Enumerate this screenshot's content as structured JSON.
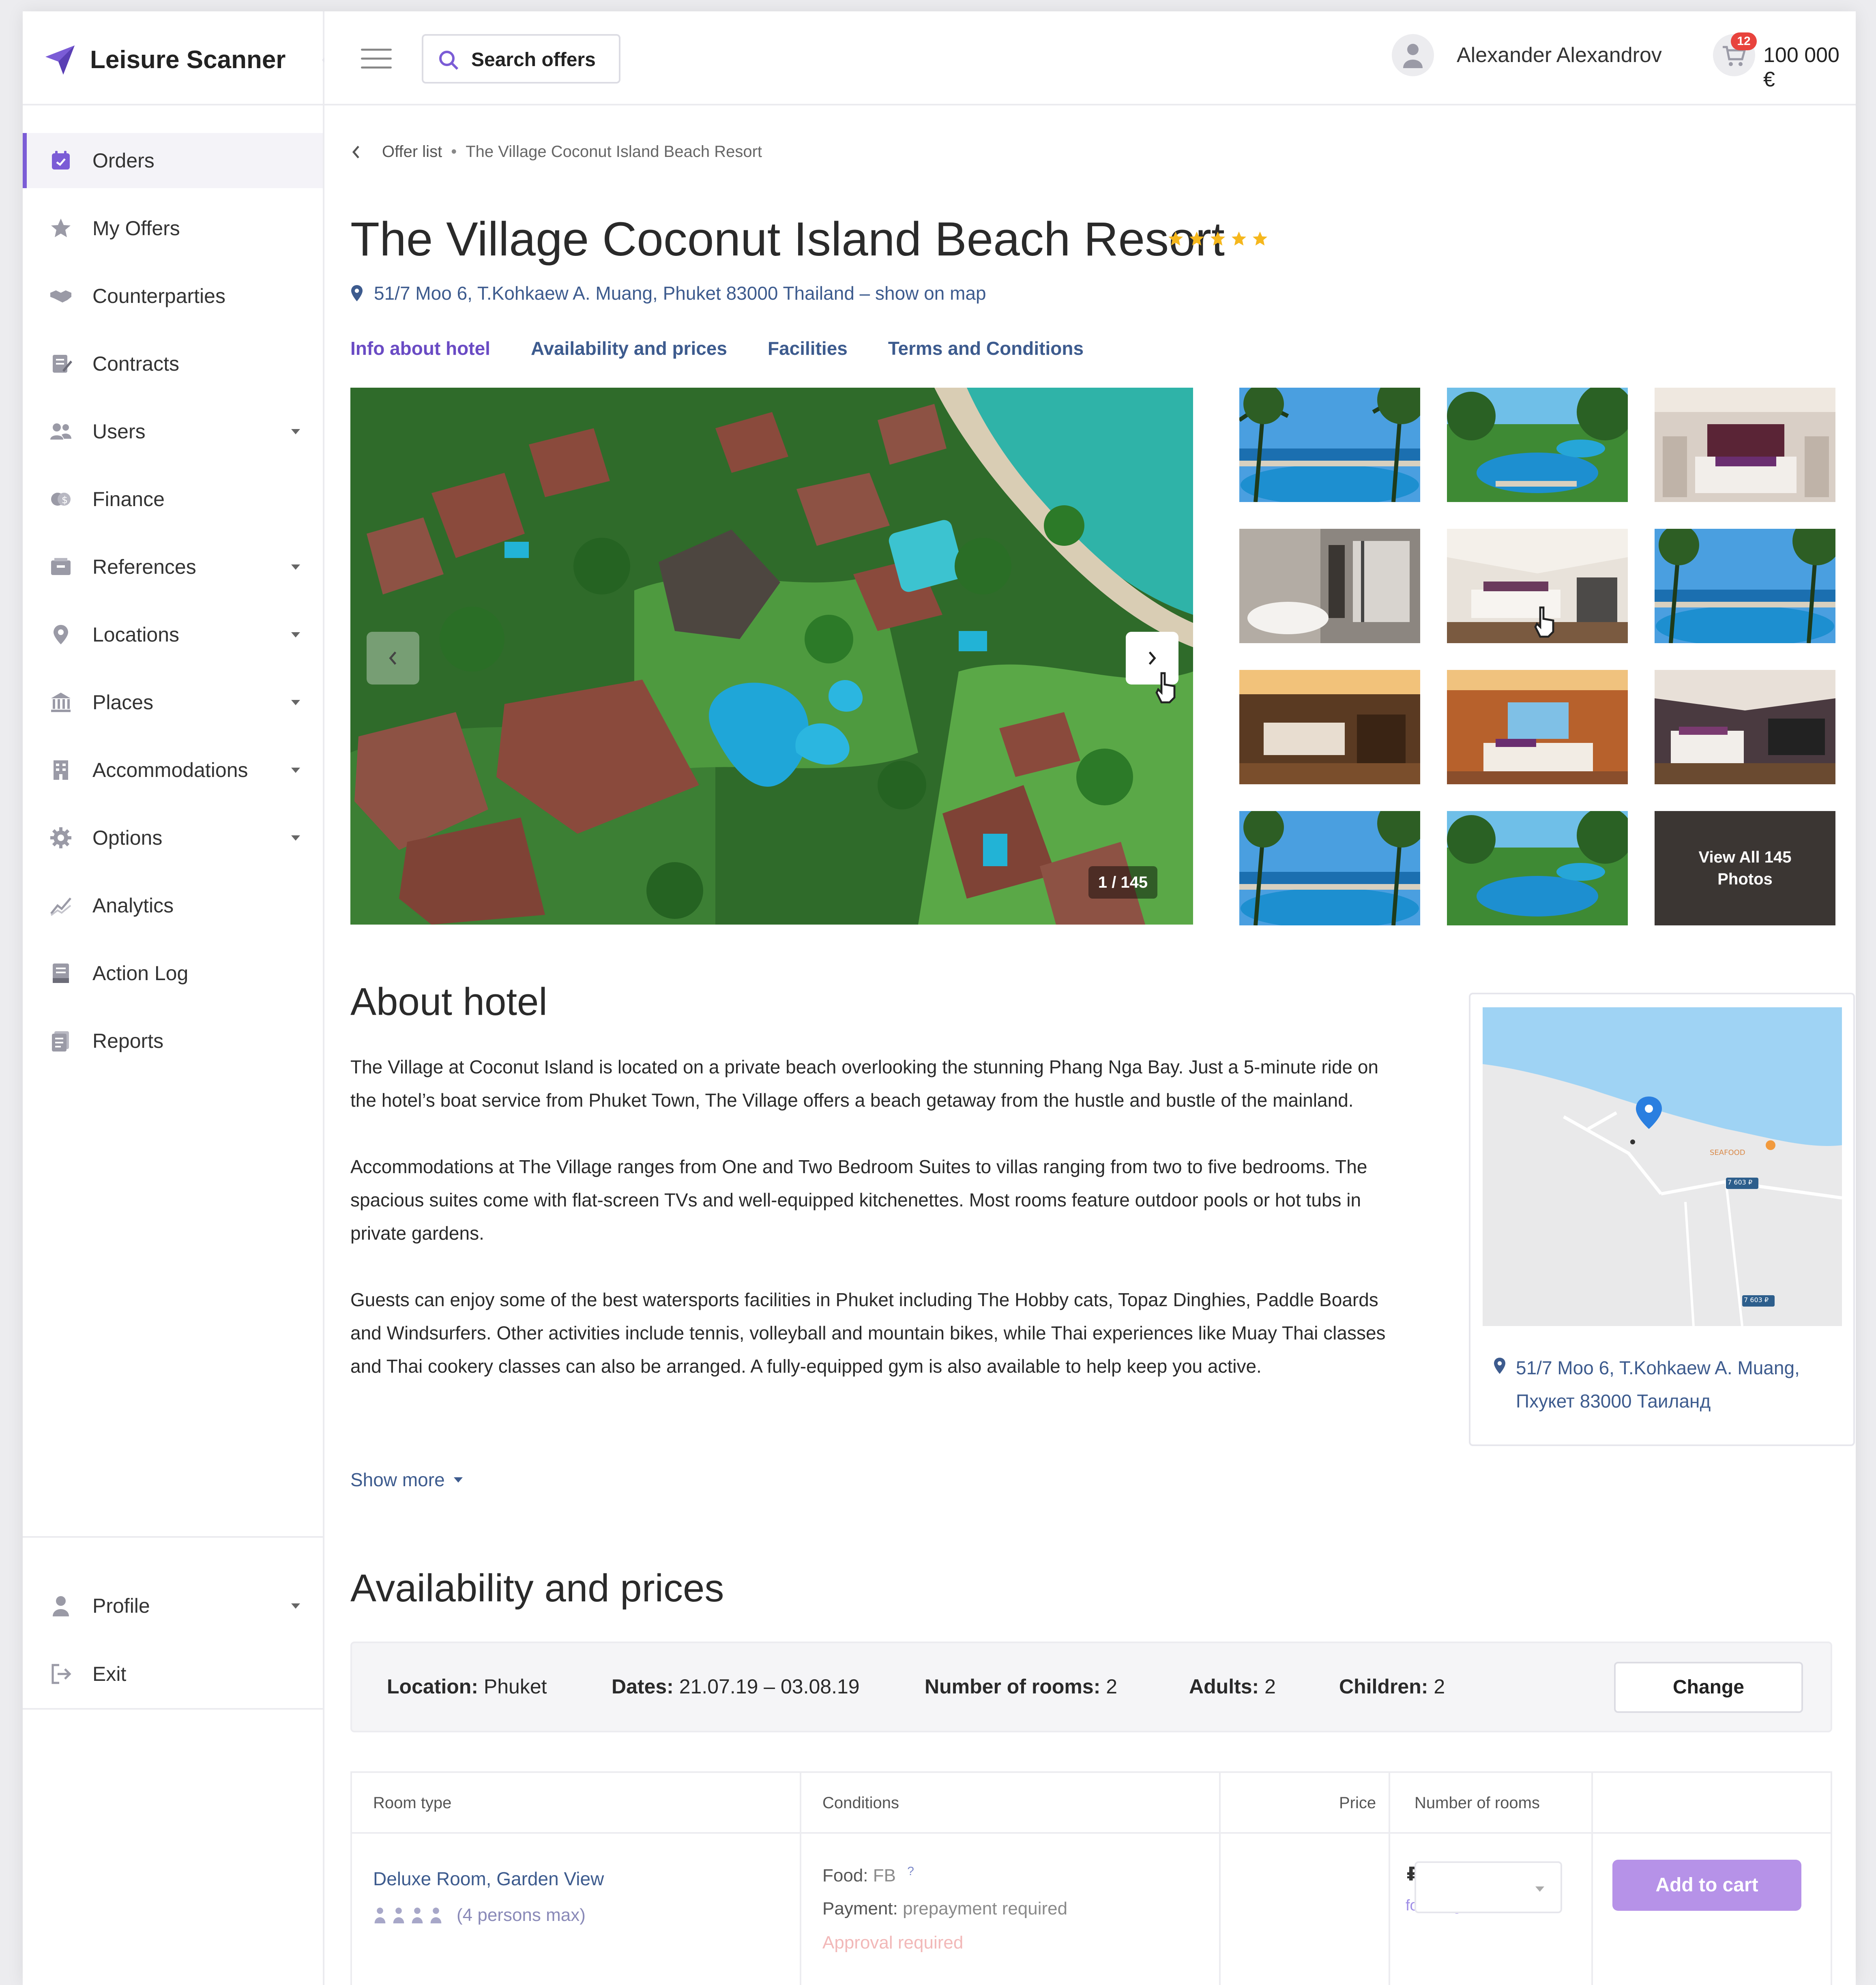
{
  "app": {
    "brand": "Leisure Scanner",
    "accent_color": "#7b5cd6"
  },
  "sidebar": {
    "items": [
      {
        "label": "Orders",
        "icon": "orders-icon",
        "active": true,
        "has_caret": false
      },
      {
        "label": "My Offers",
        "icon": "star-icon",
        "active": false,
        "has_caret": false
      },
      {
        "label": "Counterparties",
        "icon": "handshake-icon",
        "active": false,
        "has_caret": false
      },
      {
        "label": "Contracts",
        "icon": "contract-icon",
        "active": false,
        "has_caret": false
      },
      {
        "label": "Users",
        "icon": "users-icon",
        "active": false,
        "has_caret": true
      },
      {
        "label": "Finance",
        "icon": "coins-icon",
        "active": false,
        "has_caret": false
      },
      {
        "label": "References",
        "icon": "inbox-icon",
        "active": false,
        "has_caret": true
      },
      {
        "label": "Locations",
        "icon": "location-pin-icon",
        "active": false,
        "has_caret": true
      },
      {
        "label": "Places",
        "icon": "building-icon",
        "active": false,
        "has_caret": true
      },
      {
        "label": "Accommodations",
        "icon": "hotel-icon",
        "active": false,
        "has_caret": true
      },
      {
        "label": "Options",
        "icon": "gear-icon",
        "active": false,
        "has_caret": true
      },
      {
        "label": "Analytics",
        "icon": "chart-line-icon",
        "active": false,
        "has_caret": false
      },
      {
        "label": "Action Log",
        "icon": "log-icon",
        "active": false,
        "has_caret": false
      },
      {
        "label": "Reports",
        "icon": "report-icon",
        "active": false,
        "has_caret": false
      }
    ],
    "bottom": [
      {
        "label": "Profile",
        "icon": "user-icon",
        "has_caret": true
      },
      {
        "label": "Exit",
        "icon": "exit-icon",
        "has_caret": false
      }
    ]
  },
  "header": {
    "search_label": "Search offers",
    "user_name": "Alexander Alexandrov",
    "cart_count": "12",
    "balance": "100 000 €"
  },
  "breadcrumb": {
    "parent": "Offer list",
    "separator": "•",
    "current": "The Village Coconut Island Beach Resort"
  },
  "hotel": {
    "title": "The Village Coconut Island Beach Resort",
    "stars": 5,
    "address": "51/7 Moo 6, T.Kohkaew A. Muang, Phuket 83000 Thailand – show on map",
    "star_color": "#f5b71d"
  },
  "tabs": [
    {
      "label": "Info about hotel",
      "active": true
    },
    {
      "label": "Availability and prices",
      "active": false
    },
    {
      "label": "Facilities",
      "active": false
    },
    {
      "label": "Terms and Conditions",
      "active": false
    }
  ],
  "gallery": {
    "counter": "1 / 145",
    "view_all": "View All 145 Photos",
    "thumbs": [
      "pool-sea",
      "pool-garden",
      "bedroom",
      "bathroom",
      "living-room",
      "pool-sea",
      "lounge-warm",
      "living-sea-view",
      "bedroom-purple",
      "pool-sea",
      "pool-garden"
    ]
  },
  "about": {
    "title": "About hotel",
    "paragraphs": [
      "The Village at Coconut Island is located on a private beach overlooking the stunning Phang Nga Bay. Just a 5-minute ride on the hotel’s boat service from Phuket Town, The Village offers a beach getaway from the hustle and bustle of the mainland.",
      "Accommodations at The Village ranges from One and Two Bedroom Suites to villas ranging from two to five bedrooms. The spacious suites come with flat-screen TVs and well-equipped kitchenettes. Most rooms feature outdoor pools or hot tubs in private gardens.",
      "Guests can enjoy some of the best watersports facilities in Phuket including The Hobby cats, Topaz Dinghies, Paddle Boards and Windsurfers. Other activities include tennis, volleyball and mountain bikes, while Thai experiences like Muay Thai classes and Thai cookery classes can also be arranged. A fully-equipped gym is also available to help keep you active."
    ],
    "show_more": "Show more"
  },
  "map": {
    "address": "51/7 Moo 6, T.Kohkaew A. Muang, Пхукет 83000 Таиланд",
    "label_seafood": "SEAFOOD",
    "label_road_1": "7 603 ₽",
    "label_road_2": "7 603 ₽"
  },
  "availability": {
    "title": "Availability and prices",
    "location_label": "Location:",
    "location": "Phuket",
    "dates_label": "Dates:",
    "dates": "21.07.19 – 03.08.19",
    "rooms_label": "Number of rooms:",
    "rooms": "2",
    "adults_label": "Adults:",
    "adults": "2",
    "children_label": "Children:",
    "children": "2",
    "change_label": "Change"
  },
  "room_table": {
    "headers": {
      "room_type": "Room type",
      "conditions": "Conditions",
      "price": "Price",
      "number_of_rooms": "Number of rooms"
    },
    "rows": [
      {
        "room_type": "Deluxe Room, Garden View",
        "persons": "(4 persons max)",
        "food_label": "Food:",
        "food": "FB",
        "help": "?",
        "payment_label": "Payment:",
        "payment": "prepayment required",
        "approval": "Approval required",
        "price": "₽ 83 694",
        "price_note": "for 8 nights",
        "add_to_cart": "Add to cart"
      }
    ]
  }
}
